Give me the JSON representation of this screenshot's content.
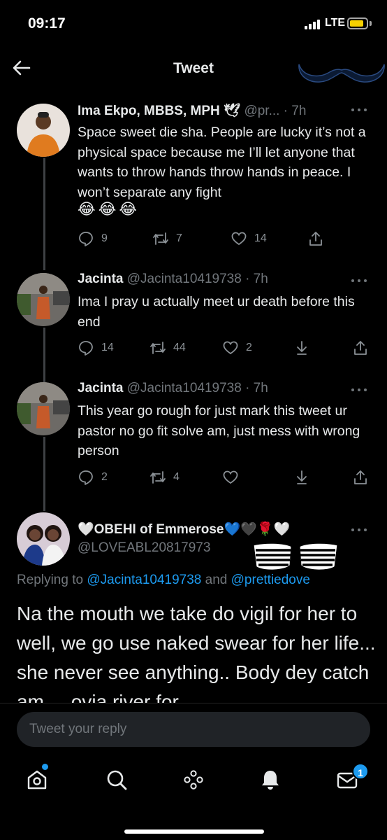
{
  "status_bar": {
    "time": "09:17",
    "network": "LTE"
  },
  "header": {
    "title": "Tweet"
  },
  "tweets": [
    {
      "name": "Ima Ekpo, MBBS, MPH 🕊",
      "handle": "@pr... · 7h",
      "text": "Space sweet die sha. People are lucky it’s not a physical space because me I’ll let anyone that wants to throw hands throw hands in peace. I won’t separate any fight",
      "emojis": "😂😂😂",
      "replies": "9",
      "retweets": "7",
      "likes": "14"
    },
    {
      "name": "Jacinta",
      "handle": "@Jacinta10419738 · 7h",
      "text": "Ima I pray u actually meet ur death before this end",
      "replies": "14",
      "retweets": "44",
      "likes": "2"
    },
    {
      "name": "Jacinta",
      "handle": "@Jacinta10419738 · 7h",
      "text": "This year go rough for just mark this tweet ur pastor no go fit solve am, just mess with wrong person",
      "replies": "2",
      "retweets": "4",
      "likes": ""
    }
  ],
  "main_tweet": {
    "name": "🤍OBEHI of Emmerose💙🖤🌹🤍",
    "handle": "@LOVEABL20817973",
    "replying_label": "Replying to",
    "mention_1": "@Jacinta10419738",
    "and_label": "and",
    "mention_2": "@prettiedove",
    "text": "Na the mouth we take do vigil for her to well, we go use naked swear for her life... she never see anything.. Body dey catch am.... ovia river for"
  },
  "compose": {
    "placeholder": "Tweet your reply"
  },
  "nav": {
    "notification_count": "1"
  },
  "colors": {
    "accent": "#1d9bf0",
    "background": "#000000",
    "secondary_text": "#71767b"
  },
  "icons": [
    "back-arrow-icon",
    "more-icon",
    "reply-icon",
    "retweet-icon",
    "like-icon",
    "share-icon",
    "download-icon",
    "home-icon",
    "search-icon",
    "spaces-icon",
    "bell-icon",
    "mail-icon"
  ]
}
